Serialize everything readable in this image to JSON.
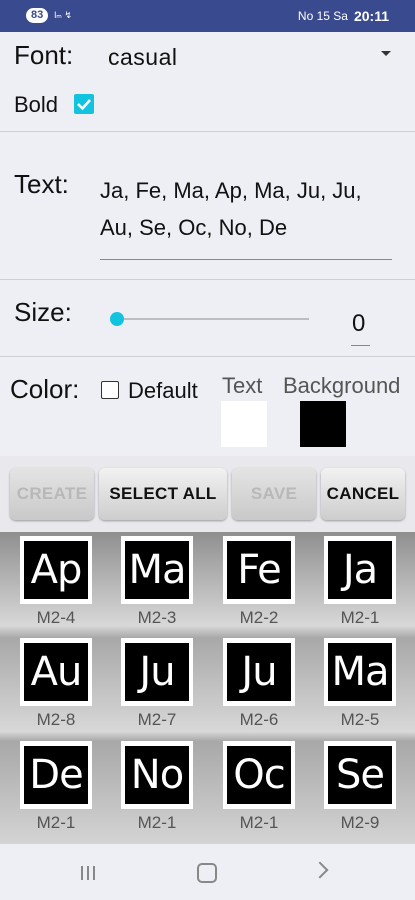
{
  "status_bar": {
    "badge": "83",
    "left_icons_text": "lₘ ↯",
    "right_text": "No 15 Sa",
    "time": "20:11"
  },
  "font": {
    "label": "Font:",
    "value": "casual",
    "bold_label": "Bold",
    "bold_checked": true
  },
  "text_section": {
    "label": "Text:",
    "value": "Ja, Fe, Ma, Ap, Ma, Ju, Ju, Au, Se, Oc, No, De"
  },
  "size": {
    "label": "Size:",
    "value": "0",
    "slider_fraction": 0
  },
  "color": {
    "label": "Color:",
    "default_label": "Default",
    "default_checked": false,
    "text_label": "Text",
    "background_label": "Background",
    "text_color": "#ffffff",
    "background_color": "#000000"
  },
  "buttons": {
    "create": "CREATE",
    "select_all": "SELECT ALL",
    "save": "SAVE",
    "cancel": "CANCEL"
  },
  "tiles": [
    {
      "text": "Ap",
      "caption": "M2-4"
    },
    {
      "text": "Ma",
      "caption": "M2-3"
    },
    {
      "text": "Fe",
      "caption": "M2-2"
    },
    {
      "text": "Ja",
      "caption": "M2-1"
    },
    {
      "text": "Au",
      "caption": "M2-8"
    },
    {
      "text": "Ju",
      "caption": "M2-7"
    },
    {
      "text": "Ju",
      "caption": "M2-6"
    },
    {
      "text": "Ma",
      "caption": "M2-5"
    },
    {
      "text": "De",
      "caption": "M2-1"
    },
    {
      "text": "No",
      "caption": "M2-1"
    },
    {
      "text": "Oc",
      "caption": "M2-1"
    },
    {
      "text": "Se",
      "caption": "M2-9"
    }
  ],
  "accent_color": "#12c3e0",
  "status_bar_color": "#3a4a8e"
}
